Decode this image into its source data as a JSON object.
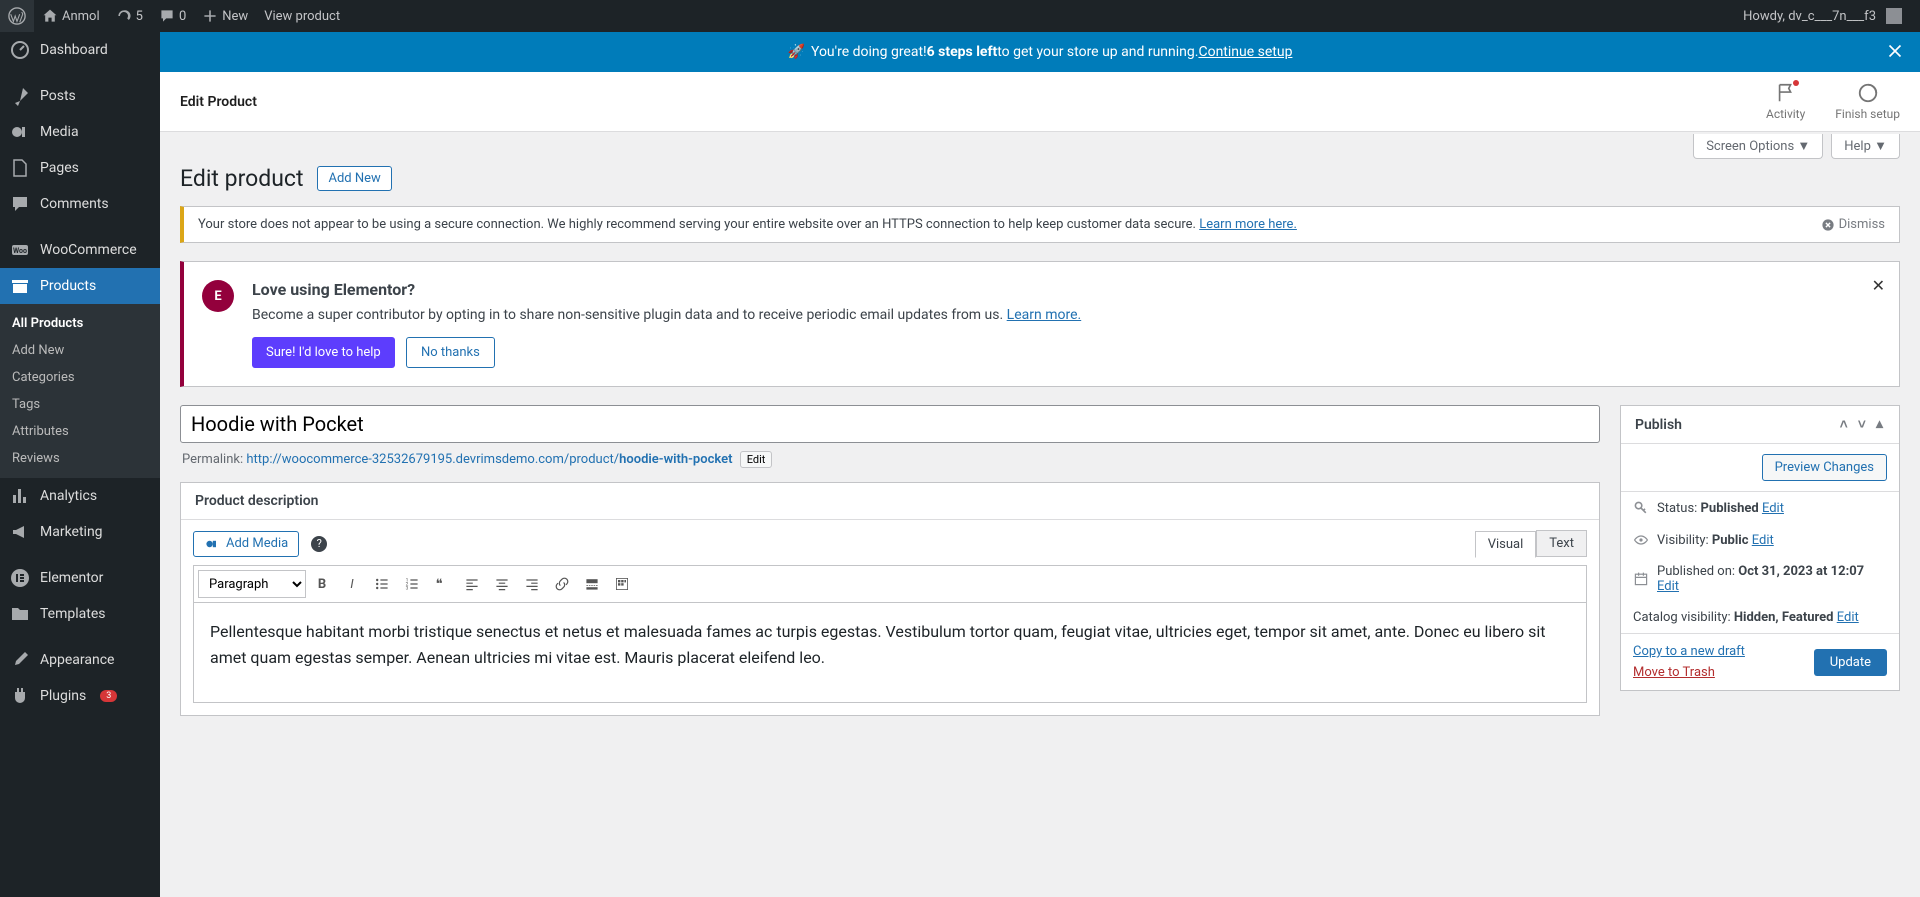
{
  "adminbar": {
    "site_name": "Anmol",
    "updates_count": "5",
    "comments_count": "0",
    "new_label": "New",
    "view_label": "View product",
    "howdy": "Howdy, dv_c___7n___f3"
  },
  "sidebar": {
    "items": [
      {
        "label": "Dashboard"
      },
      {
        "label": "Posts"
      },
      {
        "label": "Media"
      },
      {
        "label": "Pages"
      },
      {
        "label": "Comments"
      },
      {
        "label": "WooCommerce"
      },
      {
        "label": "Products"
      },
      {
        "label": "Analytics"
      },
      {
        "label": "Marketing"
      },
      {
        "label": "Elementor"
      },
      {
        "label": "Templates"
      },
      {
        "label": "Appearance"
      },
      {
        "label": "Plugins"
      }
    ],
    "plugins_badge": "3",
    "products_sub": [
      {
        "label": "All Products"
      },
      {
        "label": "Add New"
      },
      {
        "label": "Categories"
      },
      {
        "label": "Tags"
      },
      {
        "label": "Attributes"
      },
      {
        "label": "Reviews"
      }
    ]
  },
  "banner": {
    "text_lead": "You're doing great! ",
    "text_bold": "6 steps left",
    "text_tail": " to get your store up and running. ",
    "link": "Continue setup"
  },
  "page_header": {
    "title": "Edit Product",
    "activity": "Activity",
    "finish": "Finish setup"
  },
  "screen_meta": {
    "screen_options": "Screen Options",
    "help": "Help"
  },
  "heading": {
    "title": "Edit product",
    "add_new": "Add New"
  },
  "https_notice": {
    "text": "Your store does not appear to be using a secure connection. We highly recommend serving your entire website over an HTTPS connection to help keep customer data secure. ",
    "link": "Learn more here.",
    "dismiss": "Dismiss"
  },
  "elementor_notice": {
    "title": "Love using Elementor?",
    "body": "Become a super contributor by opting in to share non-sensitive plugin data and to receive periodic email updates from us. ",
    "learn": "Learn more.",
    "yes": "Sure! I'd love to help",
    "no": "No thanks"
  },
  "product": {
    "title": "Hoodie with Pocket",
    "permalink_label": "Permalink: ",
    "permalink_base": "http://woocommerce-32532679195.devrimsdemo.com/product/",
    "permalink_slug": "hoodie-with-pocket",
    "edit_slug": "Edit"
  },
  "description": {
    "box_title": "Product description",
    "add_media": "Add Media",
    "visual_tab": "Visual",
    "text_tab": "Text",
    "format": "Paragraph",
    "body": "Pellentesque habitant morbi tristique senectus et netus et malesuada fames ac turpis egestas. Vestibulum tortor quam, feugiat vitae, ultricies eget, tempor sit amet, ante. Donec eu libero sit amet quam egestas semper. Aenean ultricies mi vitae est. Mauris placerat eleifend leo."
  },
  "publish": {
    "box_title": "Publish",
    "preview": "Preview Changes",
    "status_label": "Status: ",
    "status_val": "Published",
    "edit": "Edit",
    "visibility_label": "Visibility: ",
    "visibility_val": "Public",
    "published_label": "Published on: ",
    "published_val": "Oct 31, 2023 at 12:07",
    "catalog_label": "Catalog visibility: ",
    "catalog_val": "Hidden, Featured",
    "copy": "Copy to a new draft",
    "trash": "Move to Trash",
    "update": "Update"
  }
}
